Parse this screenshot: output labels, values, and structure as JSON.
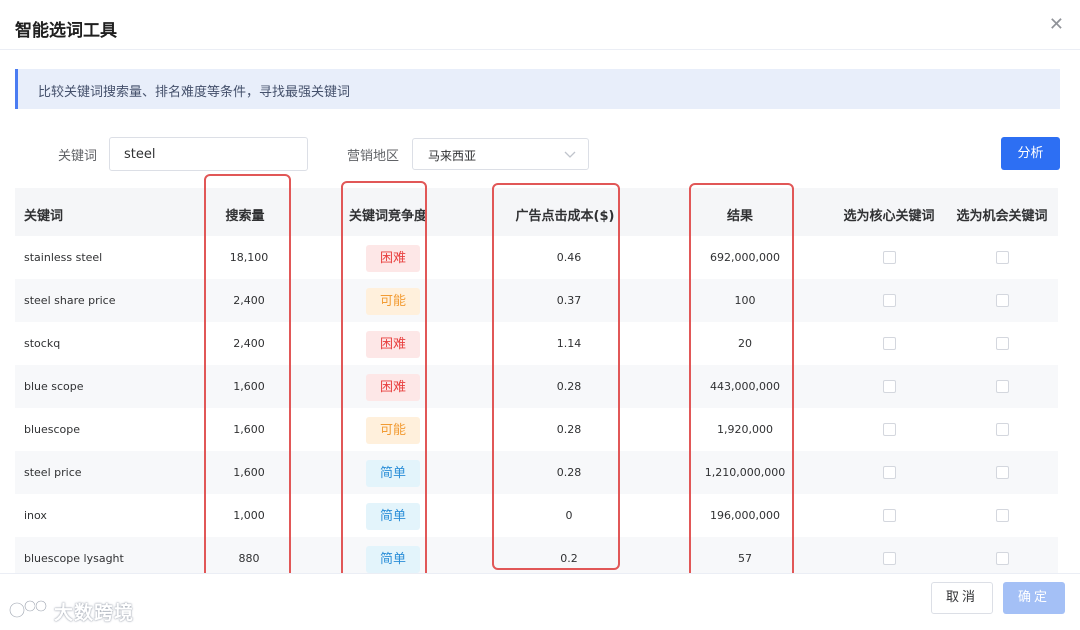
{
  "dialog": {
    "title": "智能选词工具",
    "close_icon": "close-icon",
    "notice": "比较关键词搜索量、排名难度等条件，寻找最强关键词"
  },
  "form": {
    "keyword_label": "关键词",
    "keyword_value": "steel",
    "region_label": "营销地区",
    "region_value": "马来西亚",
    "analyze_label": "分析"
  },
  "table": {
    "headers": [
      "关键词",
      "搜索量",
      "关键词竞争度",
      "广告点击成本($)",
      "结果",
      "选为核心关键词",
      "选为机会关键词"
    ],
    "rows": [
      {
        "keyword": "stainless steel",
        "volume": "18,100",
        "competition": "困难",
        "level": "hard",
        "cpc": "0.46",
        "results": "692,000,000"
      },
      {
        "keyword": "steel share price",
        "volume": "2,400",
        "competition": "可能",
        "level": "maybe",
        "cpc": "0.37",
        "results": "100"
      },
      {
        "keyword": "stockq",
        "volume": "2,400",
        "competition": "困难",
        "level": "hard",
        "cpc": "1.14",
        "results": "20"
      },
      {
        "keyword": "blue scope",
        "volume": "1,600",
        "competition": "困难",
        "level": "hard",
        "cpc": "0.28",
        "results": "443,000,000"
      },
      {
        "keyword": "bluescope",
        "volume": "1,600",
        "competition": "可能",
        "level": "maybe",
        "cpc": "0.28",
        "results": "1,920,000"
      },
      {
        "keyword": "steel price",
        "volume": "1,600",
        "competition": "简单",
        "level": "easy",
        "cpc": "0.28",
        "results": "1,210,000,000"
      },
      {
        "keyword": "inox",
        "volume": "1,000",
        "competition": "简单",
        "level": "easy",
        "cpc": "0",
        "results": "196,000,000"
      },
      {
        "keyword": "bluescope lysaght",
        "volume": "880",
        "competition": "简单",
        "level": "easy",
        "cpc": "0.2",
        "results": "57"
      }
    ]
  },
  "footer": {
    "cancel_label": "取消",
    "confirm_label": "确定"
  },
  "watermark": {
    "text": "大数跨境"
  },
  "colors": {
    "primary": "#2d6ff3",
    "highlight_box": "#e15757",
    "hard": "#e8403f",
    "maybe": "#f29b33",
    "easy": "#2c8fd8"
  }
}
